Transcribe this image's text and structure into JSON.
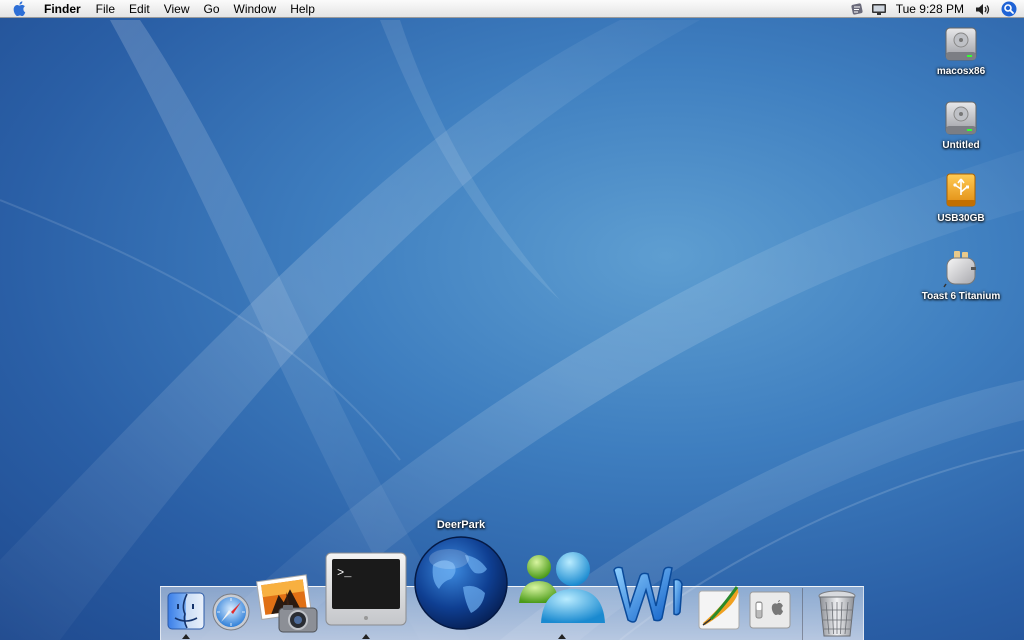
{
  "menubar": {
    "app_name": "Finder",
    "menus": [
      "File",
      "Edit",
      "View",
      "Go",
      "Window",
      "Help"
    ],
    "clock": "Tue 9:28 PM",
    "status_icons": [
      "script-menu-icon",
      "display-icon",
      "volume-icon"
    ],
    "spotlight_icon": "spotlight-icon"
  },
  "desktop": {
    "icons": [
      {
        "label": "macosx86",
        "icon": "hard-drive-icon"
      },
      {
        "label": "Untitled",
        "icon": "hard-drive-icon"
      },
      {
        "label": "USB30GB",
        "icon": "usb-drive-icon"
      },
      {
        "label": "Toast 6 Titanium",
        "icon": "toaster-icon"
      }
    ]
  },
  "dock": {
    "tooltip": "DeerPark",
    "items": [
      {
        "name": "Finder",
        "icon": "finder-icon",
        "running": true
      },
      {
        "name": "Safari",
        "icon": "safari-compass-icon",
        "running": false
      },
      {
        "name": "iPhoto",
        "icon": "iphoto-icon",
        "running": false
      },
      {
        "name": "Terminal",
        "icon": "terminal-icon",
        "running": true
      },
      {
        "name": "DeerPark",
        "icon": "globe-icon",
        "running": false
      },
      {
        "name": "Messenger",
        "icon": "messenger-icon",
        "running": true
      },
      {
        "name": "Word",
        "icon": "word-icon",
        "running": false
      },
      {
        "name": "Quill",
        "icon": "quill-icon",
        "running": false
      },
      {
        "name": "System Preferences",
        "icon": "switch-icon",
        "running": false
      },
      {
        "name": "Trash",
        "icon": "trash-icon",
        "running": false
      }
    ]
  },
  "colors": {
    "desktop": "#3f7fc0",
    "menubar": "#ececec"
  }
}
